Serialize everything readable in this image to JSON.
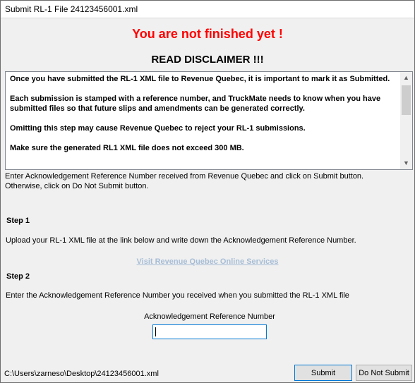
{
  "window": {
    "title": "Submit RL-1 File 24123456001.xml"
  },
  "warning": "You are not finished yet !",
  "disclaimer": {
    "title": "READ DISCLAIMER !!!",
    "paragraphs": [
      "Once you have submitted the RL-1 XML file to Revenue Quebec, it is important to mark it as Submitted.",
      "Each submission is stamped with a reference number, and TruckMate needs to know when you have submitted files so that future slips and amendments can be generated correctly.",
      "Omitting this step may cause Revenue Quebec to reject your RL-1 submissions.",
      "Make sure the generated RL1 XML file does not exceed 300 MB."
    ]
  },
  "instructions": {
    "line1": "Enter Acknowledgement Reference Number received from Revenue Quebec and click on Submit button.",
    "line2": "Otherwise, click on Do Not Submit button."
  },
  "step1": {
    "label": "Step 1",
    "text": "Upload your RL-1 XML file at the link below and write down the Acknowledgement Reference Number.",
    "link": "Visit Revenue Quebec Online Services"
  },
  "step2": {
    "label": "Step 2",
    "text": "Enter the Acknowledgement Reference Number you received when you submitted the RL-1 XML file"
  },
  "ack": {
    "label": "Acknowledgement Reference Number",
    "value": ""
  },
  "footer": {
    "path": "C:\\Users\\zarneso\\Desktop\\24123456001.xml",
    "submit_label": "Submit",
    "no_submit_label": "Do Not Submit"
  },
  "icons": {
    "scroll_up": "chevron-up-icon",
    "scroll_down": "chevron-down-icon"
  },
  "colors": {
    "warning": "#ff0000",
    "link_disabled": "#a7bdd6",
    "focus": "#0078d7"
  }
}
